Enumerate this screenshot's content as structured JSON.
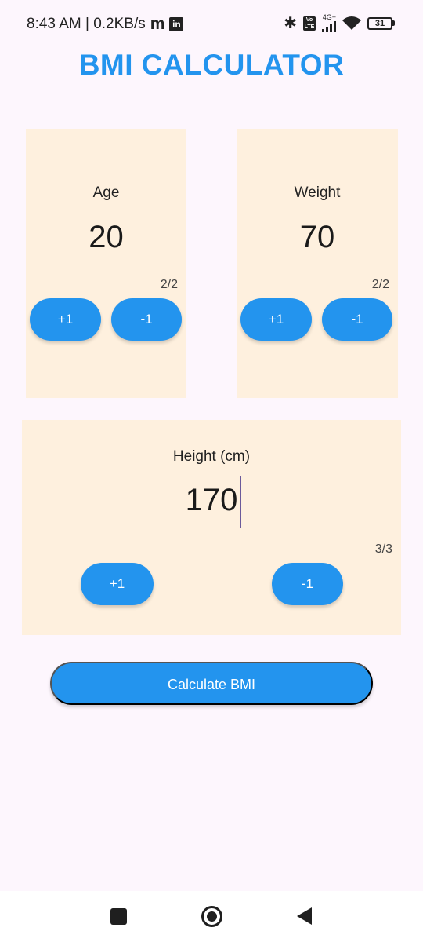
{
  "status_bar": {
    "time_speed": "8:43 AM | 0.2KB/s",
    "carrier_icon": "m",
    "linkedin_icon": "in",
    "network_type": "4G+",
    "battery_level": "31"
  },
  "title": "BMI CALCULATOR",
  "age_card": {
    "label": "Age",
    "value": "20",
    "counter": "2/2",
    "plus_label": "+1",
    "minus_label": "-1"
  },
  "weight_card": {
    "label": "Weight",
    "value": "70",
    "counter": "2/2",
    "plus_label": "+1",
    "minus_label": "-1"
  },
  "height_card": {
    "label": "Height (cm)",
    "value": "170",
    "counter": "3/3",
    "plus_label": "+1",
    "minus_label": "-1"
  },
  "calculate_button": "Calculate BMI",
  "colors": {
    "accent": "#2394ee",
    "card_background": "#fef0de",
    "page_background": "#fdf6fd"
  }
}
